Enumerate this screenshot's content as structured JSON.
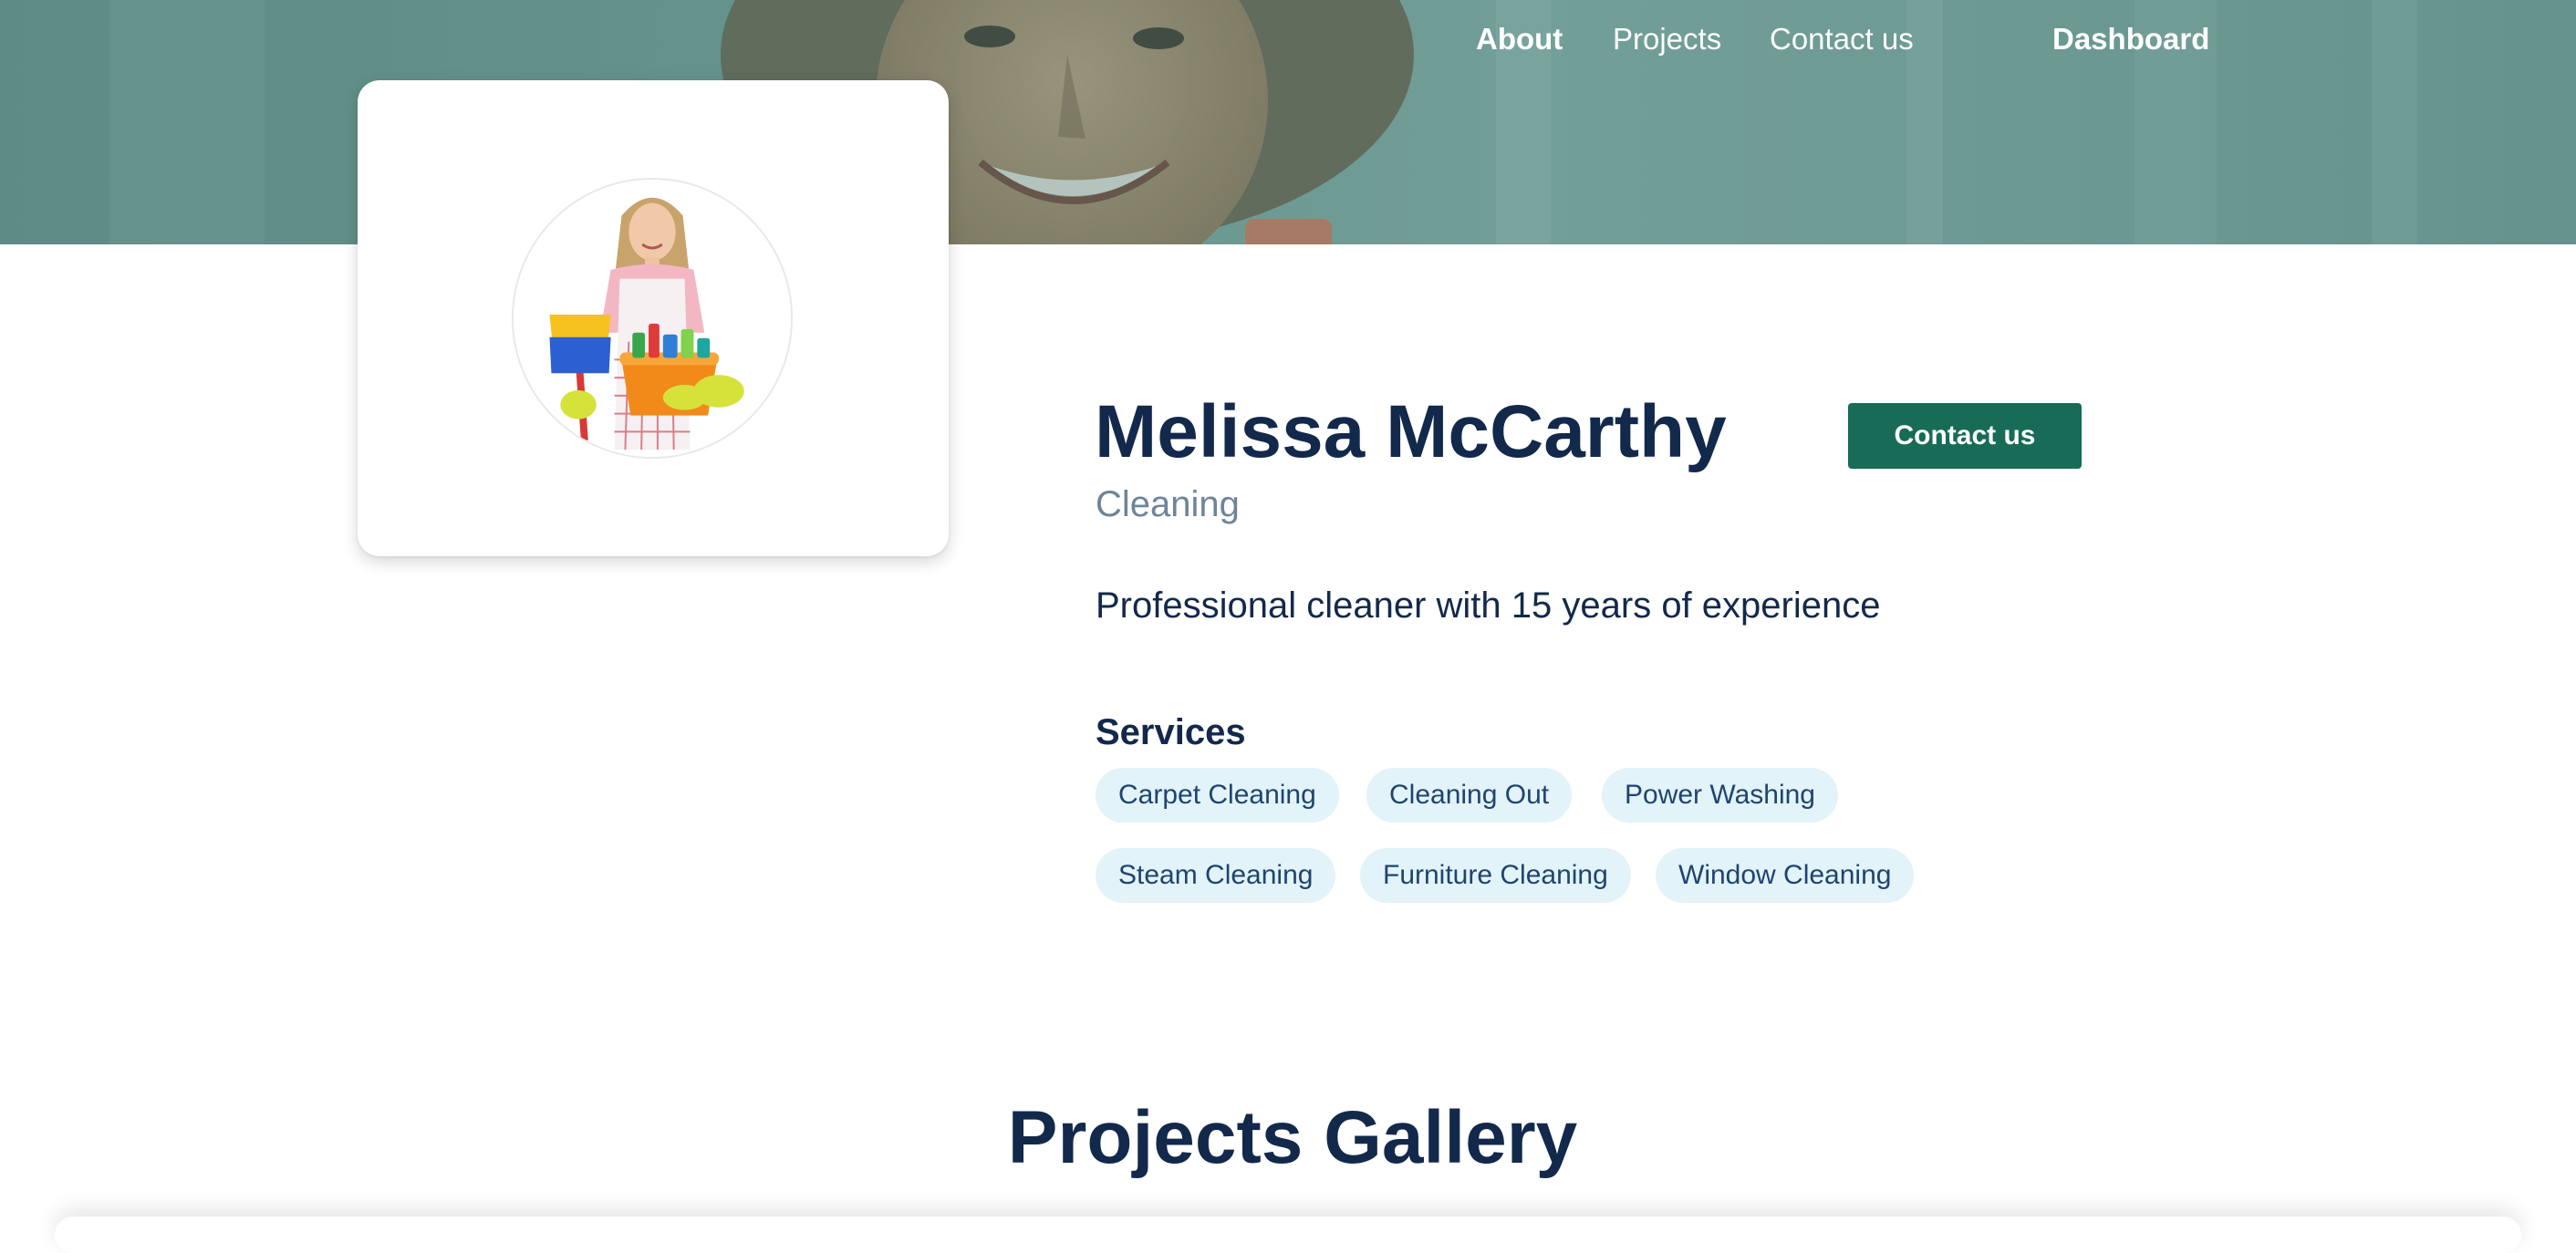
{
  "nav": {
    "items": [
      {
        "label": "About",
        "active": true
      },
      {
        "label": "Projects",
        "active": false
      },
      {
        "label": "Contact us",
        "active": false
      }
    ],
    "dashboard_label": "Dashboard"
  },
  "profile": {
    "name": "Melissa McCarthy",
    "category": "Cleaning",
    "bio": "Professional cleaner with 15 years of experience",
    "contact_button": "Contact us"
  },
  "services": {
    "heading": "Services",
    "items": [
      "Carpet Cleaning",
      "Cleaning Out",
      "Power Washing",
      "Steam Cleaning",
      "Furniture Cleaning",
      "Window Cleaning"
    ]
  },
  "gallery": {
    "title": "Projects Gallery"
  },
  "colors": {
    "brand_green": "#176b57",
    "heading_navy": "#13294b",
    "tag_background": "#e2f3f9",
    "hero_tint": "#6f9893"
  }
}
